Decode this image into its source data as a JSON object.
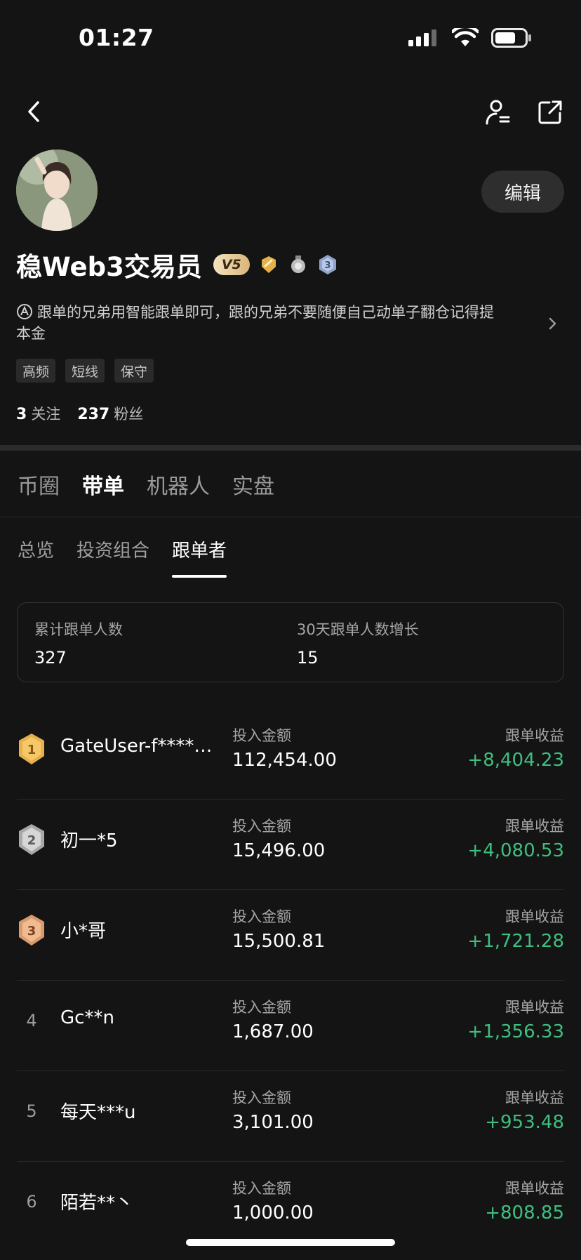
{
  "status": {
    "time": "01:27"
  },
  "profile": {
    "name": "稳Web3交易员",
    "vip": "V5",
    "bio": "跟单的兄弟用智能跟单即可，跟的兄弟不要随便自己动单子翻仓记得提本金",
    "edit_label": "编辑",
    "tags": [
      "高频",
      "短线",
      "保守"
    ],
    "following_count": "3",
    "following_label": "关注",
    "followers_count": "237",
    "followers_label": "粉丝"
  },
  "main_tabs": [
    "币圈",
    "带单",
    "机器人",
    "实盘"
  ],
  "sub_tabs": [
    "总览",
    "投资组合",
    "跟单者"
  ],
  "stats": {
    "total_label": "累计跟单人数",
    "total_value": "327",
    "growth_label": "30天跟单人数增长",
    "growth_value": "15"
  },
  "list_labels": {
    "amount": "投入金额",
    "profit": "跟单收益"
  },
  "followers": [
    {
      "rank": "1",
      "name": "GateUser-f****…",
      "amount": "112,454.00",
      "profit": "+8,404.23"
    },
    {
      "rank": "2",
      "name": "初一*5",
      "amount": "15,496.00",
      "profit": "+4,080.53"
    },
    {
      "rank": "3",
      "name": "小*哥",
      "amount": "15,500.81",
      "profit": "+1,721.28"
    },
    {
      "rank": "4",
      "name": "Gc**n",
      "amount": "1,687.00",
      "profit": "+1,356.33"
    },
    {
      "rank": "5",
      "name": "每天***u",
      "amount": "3,101.00",
      "profit": "+953.48"
    },
    {
      "rank": "6",
      "name": "陌若**丶",
      "amount": "1,000.00",
      "profit": "+808.85"
    }
  ],
  "colors": {
    "background": "#141414",
    "profit_green": "#3fbf7f",
    "gold": "#e7b04a",
    "silver": "#bdbdbd",
    "bronze": "#d99a6c"
  }
}
